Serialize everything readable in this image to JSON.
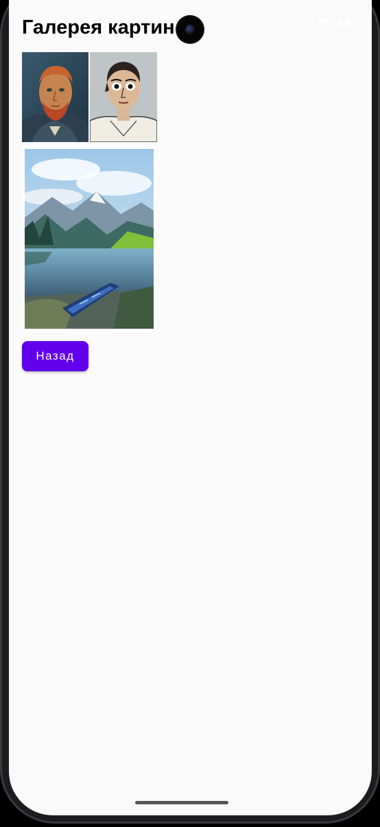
{
  "app": {
    "title": "Галерея картин"
  },
  "status_bar": {
    "icons": [
      "wifi-icon",
      "signal-icon",
      "battery-icon"
    ]
  },
  "gallery": {
    "paintings": [
      {
        "name": "vangogh-self-portrait",
        "subject": "portrait-red-beard"
      },
      {
        "name": "picasso-self-portrait",
        "subject": "portrait-dark-hair"
      },
      {
        "name": "watercolor-lake-landscape",
        "subject": "mountains-lake-boat"
      }
    ]
  },
  "actions": {
    "back_label": "Назад"
  },
  "colors": {
    "accent": "#6200ee",
    "background": "#fafafa"
  }
}
